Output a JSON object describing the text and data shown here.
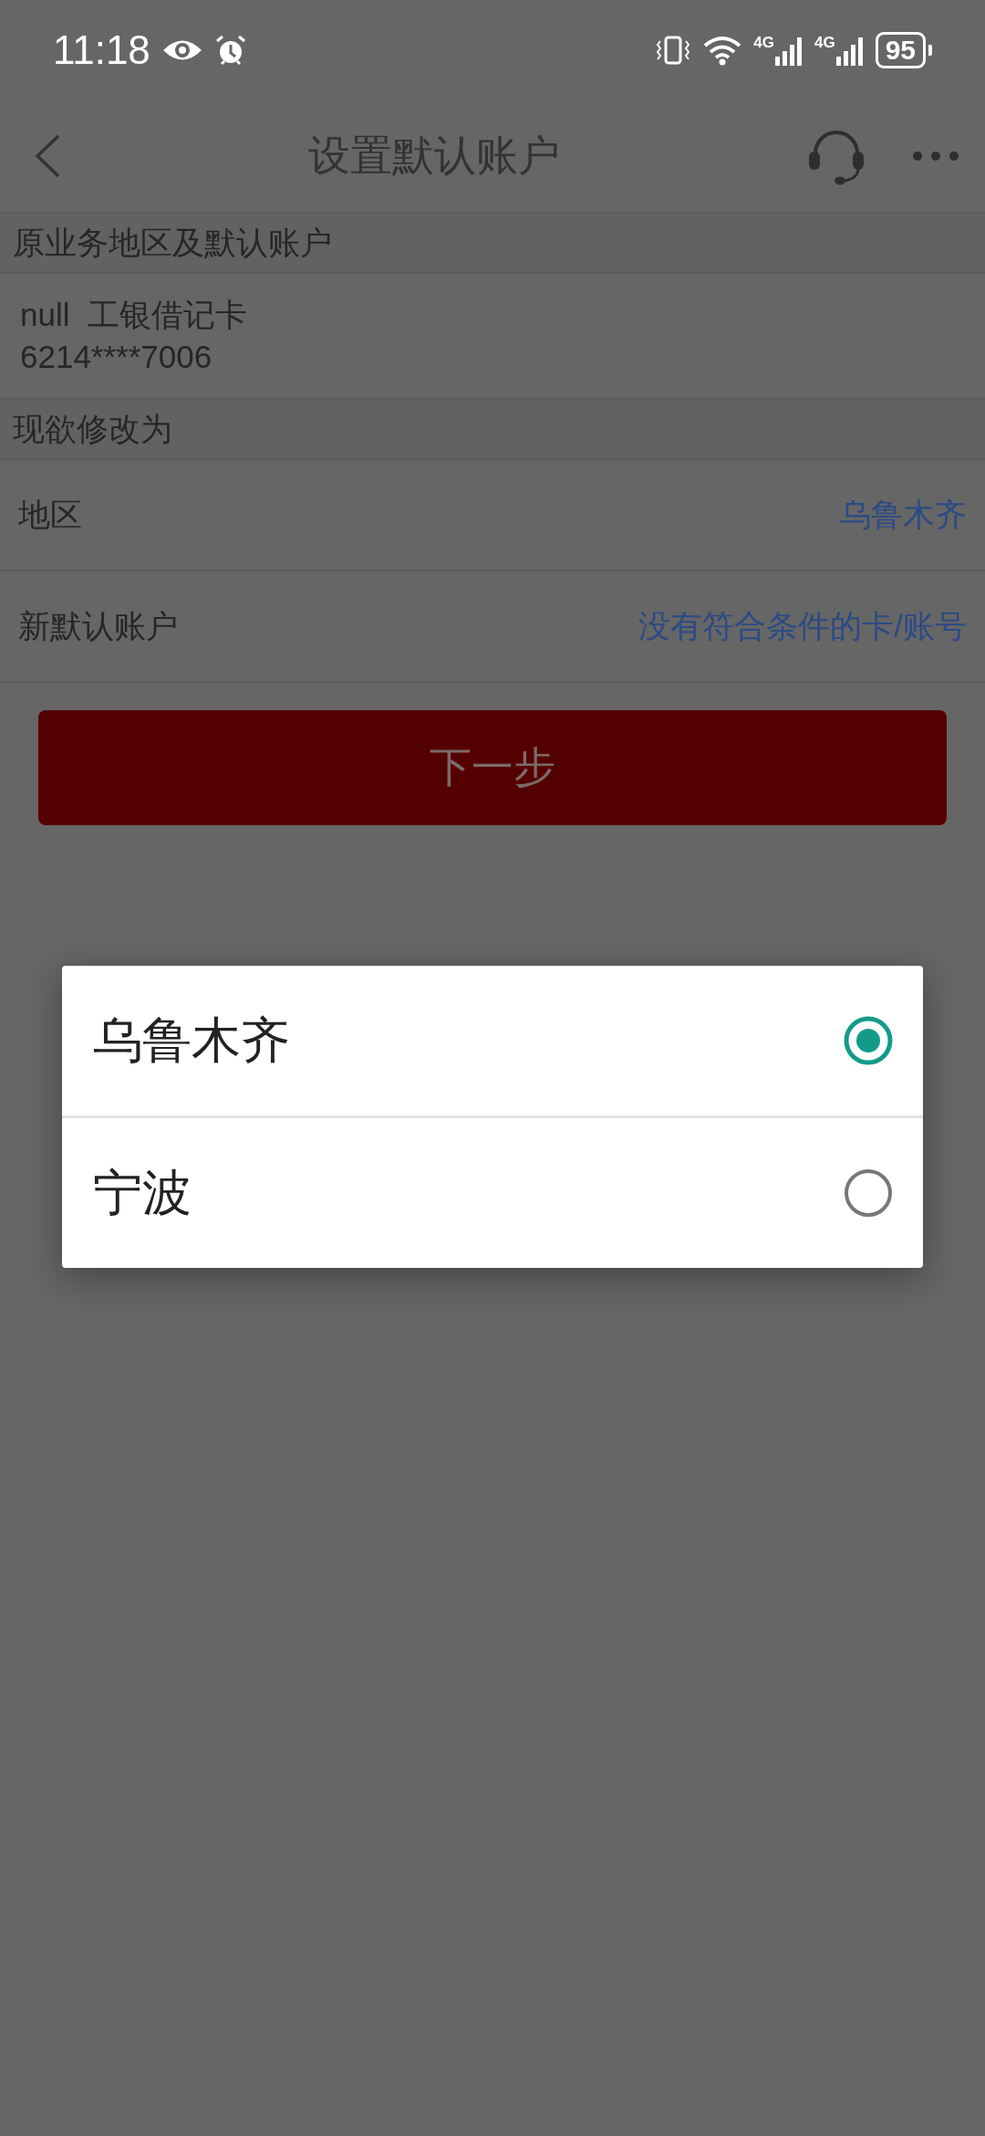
{
  "status_bar": {
    "time": "11:18",
    "network_labels": [
      "4G",
      "4G"
    ],
    "battery": "95"
  },
  "header": {
    "title": "设置默认账户"
  },
  "original_section": {
    "heading": "原业务地区及默认账户",
    "account_lines": [
      "null  工银借记卡",
      "6214****7006"
    ]
  },
  "change_section": {
    "heading": "现欲修改为",
    "rows": [
      {
        "label": "地区",
        "value": "乌鲁木齐"
      },
      {
        "label": "新默认账户",
        "value": "没有符合条件的卡/账号"
      }
    ]
  },
  "next_button": {
    "label": "下一步"
  },
  "dialog": {
    "options": [
      {
        "label": "乌鲁木齐",
        "selected": true
      },
      {
        "label": "宁波",
        "selected": false
      }
    ]
  }
}
